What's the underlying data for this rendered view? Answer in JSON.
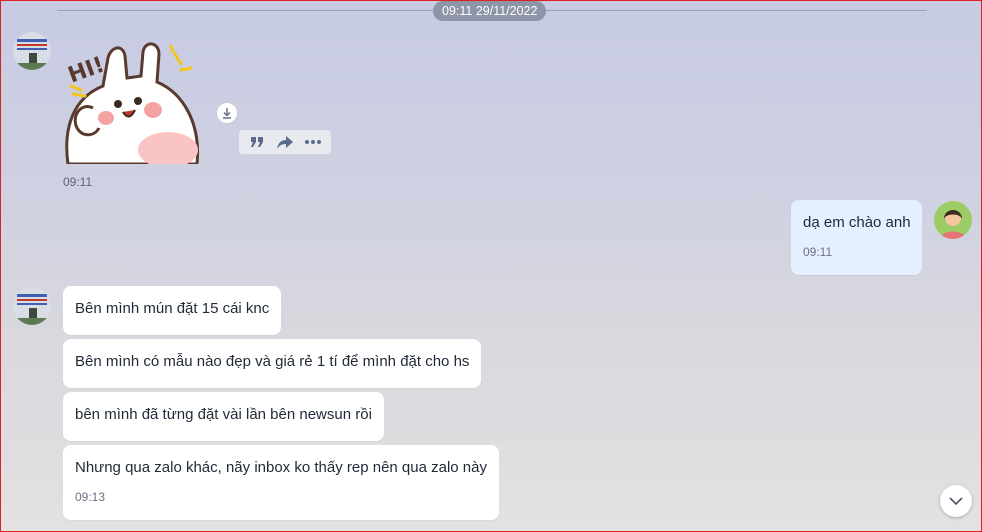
{
  "header": {
    "date_separator": "09:11 29/11/2022"
  },
  "messages": [
    {
      "sender": "other",
      "type": "sticker",
      "sticker_text": "HI!",
      "time": "09:11"
    },
    {
      "sender": "me",
      "text": "dạ em chào anh",
      "time": "09:11"
    },
    {
      "sender": "other",
      "text": "Bên mình mún đặt 15 cái knc"
    },
    {
      "sender": "other",
      "text": "Bên mình có mẫu nào đẹp và giá rẻ 1 tí để mình đặt cho hs"
    },
    {
      "sender": "other",
      "text": "bên mình đã từng đặt vài lần bên newsun rồi"
    },
    {
      "sender": "other",
      "text": "Nhưng qua zalo khác, nãy inbox ko thấy rep nên qua zalo này",
      "time": "09:13"
    }
  ],
  "icons": {
    "download": "download-icon",
    "quote": "quote-icon",
    "forward": "forward-icon",
    "more": "more-icon",
    "scroll_down": "chevron-down-icon"
  },
  "colors": {
    "my_bubble": "#e5efff",
    "their_bubble": "#ffffff",
    "date_pill": "#8f95a8",
    "frame": "#e0201e"
  }
}
